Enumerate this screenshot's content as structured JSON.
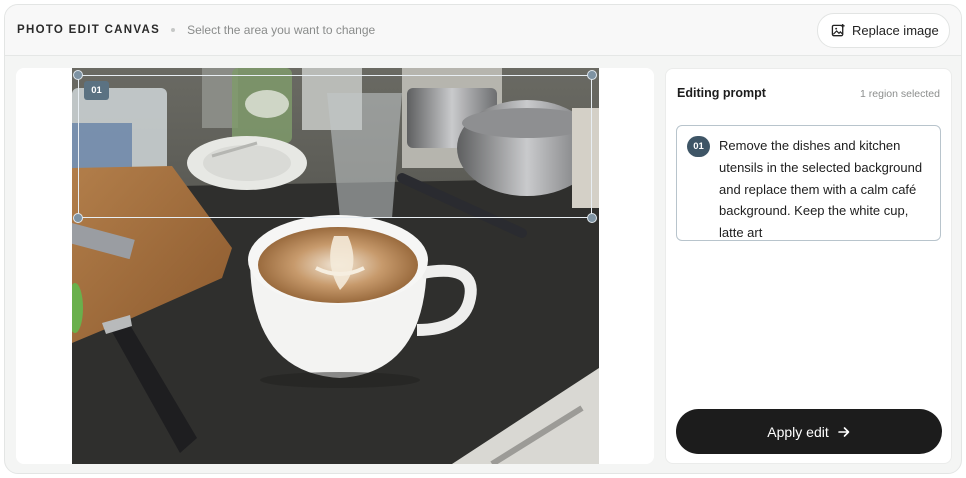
{
  "header": {
    "title": "PHOTO EDIT CANVAS",
    "subtitle": "Select the area you want to change",
    "replace_label": "Replace image"
  },
  "canvas": {
    "region_tag": "01"
  },
  "panel": {
    "title": "Editing prompt",
    "count": "1 region selected",
    "prompt_badge": "01",
    "prompt_text": "Remove the dishes and kitchen utensils in the selected background and replace them with a calm café background. Keep the white cup, latte art",
    "apply_label": "Apply edit"
  },
  "colors": {
    "accent": "#1c1c1c",
    "selection": "#5b7282"
  }
}
